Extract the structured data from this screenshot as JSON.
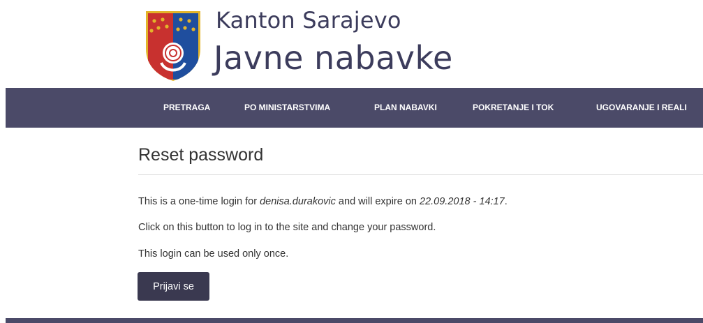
{
  "header": {
    "brand_line1": "Kanton Sarajevo",
    "brand_line2": "Javne nabavke",
    "crest_icon": "sarajevo-canton-coat-of-arms"
  },
  "nav": {
    "items": [
      {
        "label": "PRETRAGA"
      },
      {
        "label": "PO MINISTARSTVIMA"
      },
      {
        "label": "PLAN NABAVKI"
      },
      {
        "label": "POKRETANJE I TOK"
      },
      {
        "label": "UGOVARANJE I REALI"
      }
    ]
  },
  "main": {
    "title": "Reset password",
    "line1": {
      "prefix": "This is a one-time login for ",
      "username": "denisa.durakovic",
      "middle": " and will expire on ",
      "expiry": "22.09.2018 - 14:17",
      "suffix": "."
    },
    "line2": "Click on this button to log in to the site and change your password.",
    "line3": "This login can be used only once.",
    "submit_label": "Prijavi se"
  },
  "colors": {
    "navbar_bg": "#4b4a68",
    "button_bg": "#3a3950",
    "brand_text": "#3c3c5c",
    "crest_red": "#c8312f",
    "crest_blue": "#1f4e9e",
    "crest_gold": "#e3b42a"
  }
}
